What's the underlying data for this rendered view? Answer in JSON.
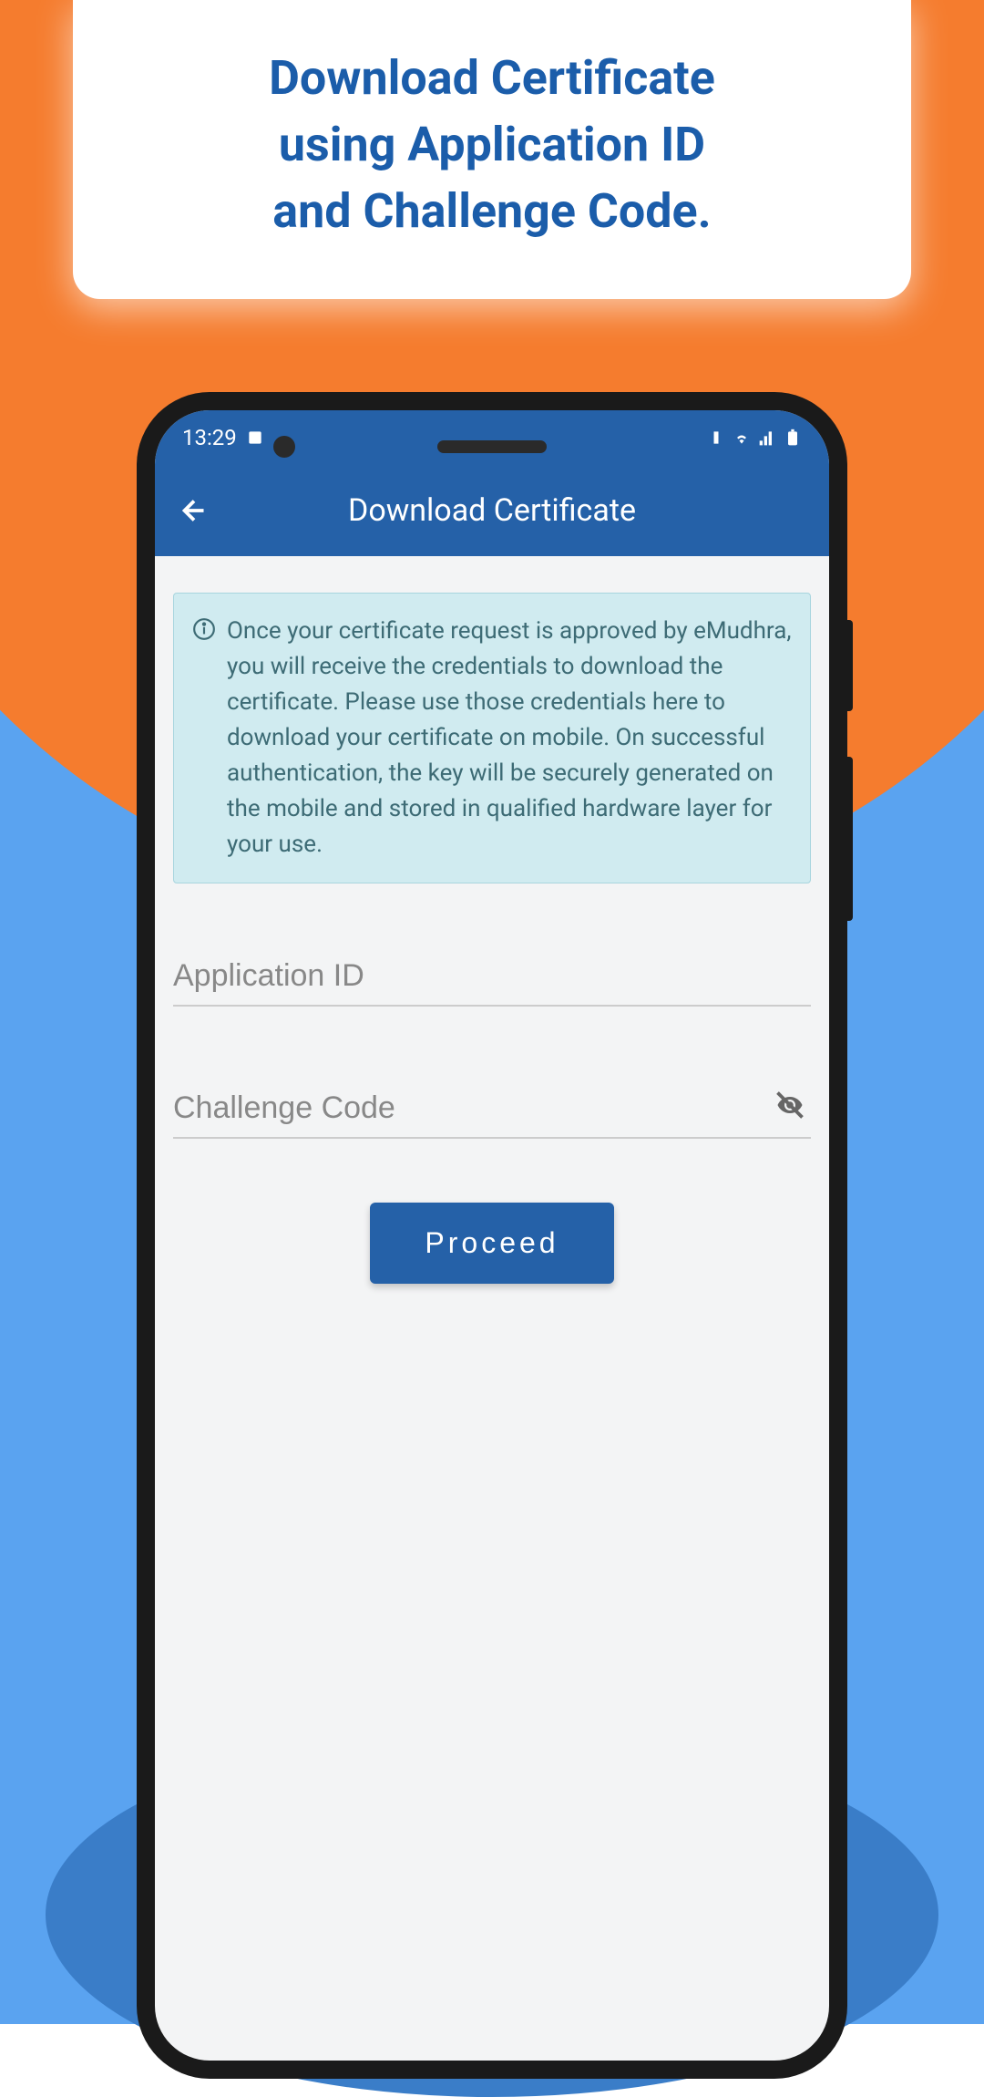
{
  "promo": {
    "title_line1": "Download Certificate",
    "title_line2": "using Application ID",
    "title_line3": "and Challenge Code."
  },
  "status_bar": {
    "time": "13:29"
  },
  "app_bar": {
    "title": "Download Certificate"
  },
  "info": {
    "text": "Once your certificate request is approved by eMudhra, you will receive the credentials to download the certificate. Please use those credentials here to download your certificate on mobile. On successful authentication, the key will be securely generated on the mobile and stored in qualified hardware layer for your use."
  },
  "form": {
    "application_id": {
      "placeholder": "Application ID",
      "value": ""
    },
    "challenge_code": {
      "placeholder": "Challenge Code",
      "value": ""
    },
    "proceed_label": "Proceed"
  }
}
